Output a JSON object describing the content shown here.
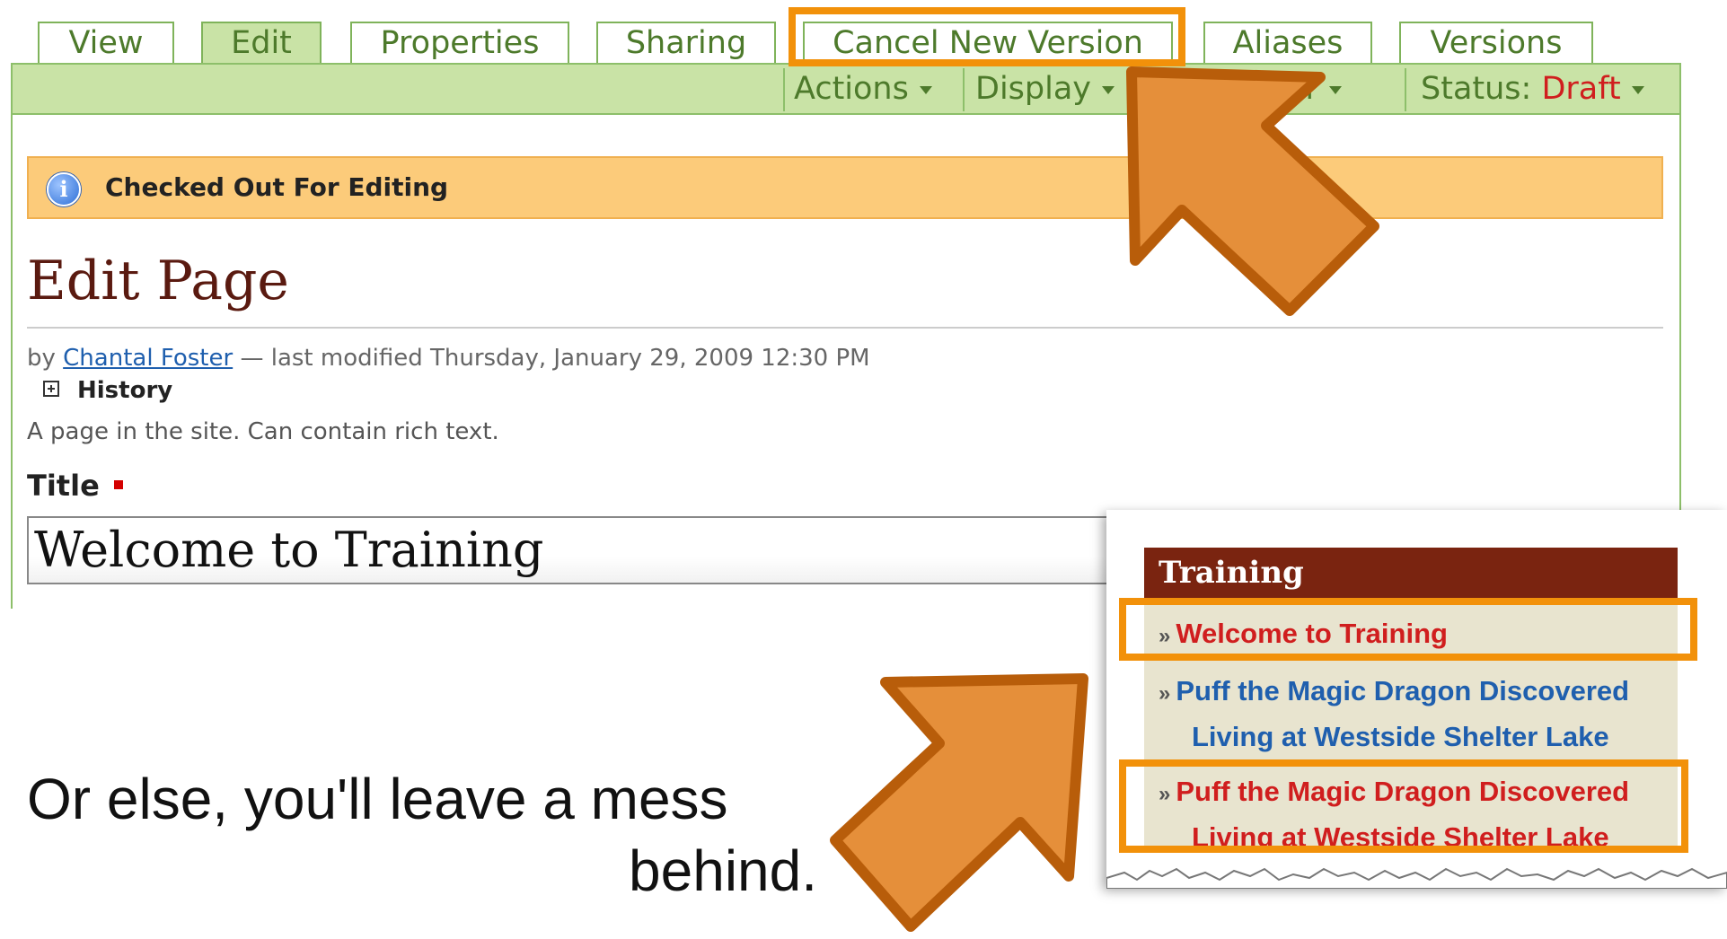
{
  "tabs": [
    {
      "label": "View",
      "active": false
    },
    {
      "label": "Edit",
      "active": true
    },
    {
      "label": "Properties",
      "active": false
    },
    {
      "label": "Sharing",
      "active": false
    },
    {
      "label": "Cancel New Version",
      "active": false
    },
    {
      "label": "Aliases",
      "active": false
    },
    {
      "label": "Versions",
      "active": false
    }
  ],
  "toolbar": {
    "actions_label": "Actions",
    "display_label": "Display",
    "hidden_menu_fragment": "er",
    "status_prefix": "Status:",
    "status_value": "Draft"
  },
  "status_message": "Checked Out For Editing",
  "page": {
    "title": "Edit Page",
    "byline_prefix": "by",
    "author": "Chantal Foster",
    "byline_suffix": "— last modified Thursday, January 29, 2009 12:30 PM",
    "history_label": "History",
    "description": "A page in the site. Can contain rich text.",
    "title_field_label": "Title",
    "title_field_value": "Welcome to Training"
  },
  "nav_panel": {
    "header": "Training",
    "items": [
      {
        "lines": [
          "Welcome to Training"
        ],
        "color": "#d01e1e",
        "highlighted": true
      },
      {
        "lines": [
          "Puff the Magic Dragon Discovered",
          "Living at Westside Shelter Lake"
        ],
        "color": "#1f5fae",
        "highlighted": false
      },
      {
        "lines": [
          "Puff the Magic Dragon Discovered",
          "Living at Westside Shelter Lake"
        ],
        "color": "#d01e1e",
        "highlighted": true
      }
    ]
  },
  "caption": {
    "line1": "Or else, you'll leave a mess",
    "line2": "behind."
  },
  "colors": {
    "tab_green": "#4d7a2b",
    "toolbar_green": "#c9e3a6",
    "status_bar": "#fccb7a",
    "highlight_orange": "#f2910a",
    "arrow_orange": "#e58f3a",
    "nav_header": "#7a2410",
    "draft_red": "#d01e1e"
  },
  "icons": [
    "info-icon",
    "expand-plus-icon",
    "chevron-down-icon",
    "double-arrow-right-icon",
    "arrow-pointer-icon"
  ]
}
